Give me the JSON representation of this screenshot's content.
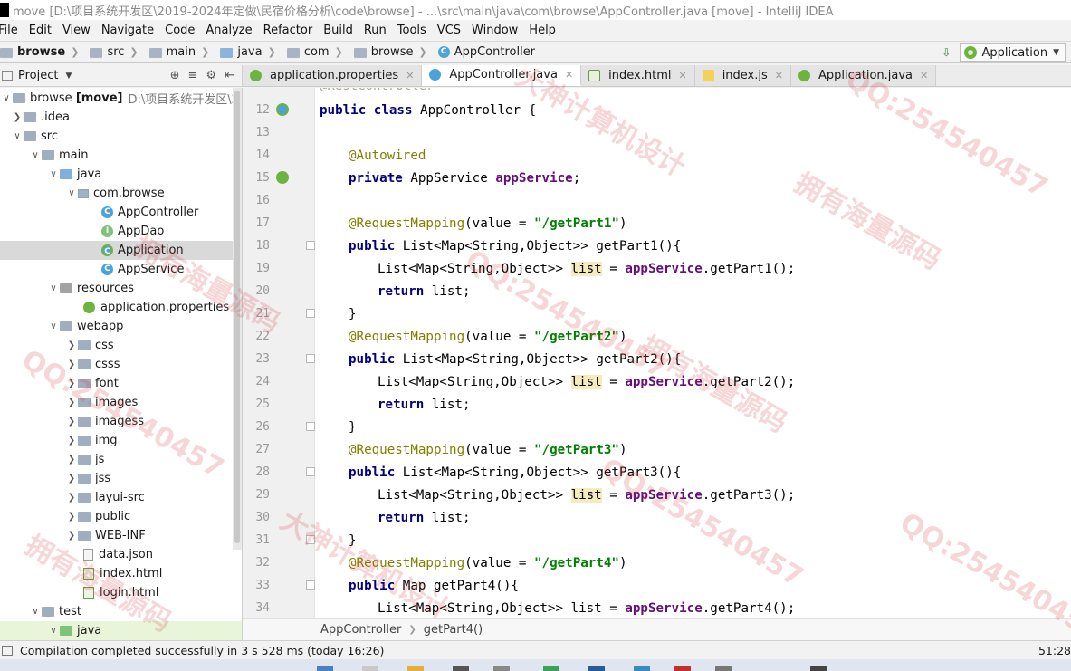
{
  "window": {
    "title": "move [D:\\项目系统开发区\\2019-2024年定做\\民宿价格分析\\code\\browse] - ...\\src\\main\\java\\com\\browse\\AppController.java [move] - IntelliJ IDEA"
  },
  "menu": [
    "File",
    "Edit",
    "View",
    "Navigate",
    "Code",
    "Analyze",
    "Refactor",
    "Build",
    "Run",
    "Tools",
    "VCS",
    "Window",
    "Help"
  ],
  "navbar": {
    "crumbs": [
      "browse",
      "src",
      "main",
      "java",
      "com",
      "browse",
      "AppController"
    ],
    "run_config": "Application"
  },
  "project_panel": {
    "title": "Project",
    "root_name": "browse",
    "root_module": "[move]",
    "root_path": "D:\\项目系统开发区\\2019-",
    "items": [
      {
        "label": ".idea",
        "icon": "folder-icon"
      },
      {
        "label": "src",
        "icon": "folder-icon"
      },
      {
        "label": "main",
        "icon": "folder-icon"
      },
      {
        "label": "java",
        "icon": "source-folder-icon"
      },
      {
        "label": "com.browse",
        "icon": "package-icon"
      },
      {
        "label": "AppController",
        "icon": "class-icon"
      },
      {
        "label": "AppDao",
        "icon": "interface-icon"
      },
      {
        "label": "Application",
        "icon": "spring-boot-class-icon"
      },
      {
        "label": "AppService",
        "icon": "class-icon"
      },
      {
        "label": "resources",
        "icon": "resources-folder-icon"
      },
      {
        "label": "application.properties",
        "icon": "spring-properties-icon"
      },
      {
        "label": "webapp",
        "icon": "folder-icon"
      },
      {
        "label": "css",
        "icon": "folder-icon"
      },
      {
        "label": "csss",
        "icon": "folder-icon"
      },
      {
        "label": "font",
        "icon": "folder-icon"
      },
      {
        "label": "images",
        "icon": "folder-icon"
      },
      {
        "label": "imagess",
        "icon": "folder-icon"
      },
      {
        "label": "img",
        "icon": "folder-icon"
      },
      {
        "label": "js",
        "icon": "folder-icon"
      },
      {
        "label": "jss",
        "icon": "folder-icon"
      },
      {
        "label": "layui-src",
        "icon": "folder-icon"
      },
      {
        "label": "public",
        "icon": "folder-icon"
      },
      {
        "label": "WEB-INF",
        "icon": "folder-icon"
      },
      {
        "label": "data.json",
        "icon": "json-file-icon"
      },
      {
        "label": "index.html",
        "icon": "html-file-icon"
      },
      {
        "label": "login.html",
        "icon": "html-file-icon"
      },
      {
        "label": "test",
        "icon": "folder-icon"
      },
      {
        "label": "java",
        "icon": "test-source-folder-icon"
      }
    ]
  },
  "tabs": [
    {
      "label": "application.properties",
      "active": false
    },
    {
      "label": "AppController.java",
      "active": true
    },
    {
      "label": "index.html",
      "active": false
    },
    {
      "label": "index.js",
      "active": false
    },
    {
      "label": "Application.java",
      "active": false
    }
  ],
  "editor": {
    "lines": [
      {
        "n": "12",
        "text": "public class AppController {"
      },
      {
        "n": "13",
        "text": ""
      },
      {
        "n": "14",
        "text": "@Autowired"
      },
      {
        "n": "15",
        "text": "private AppService appService;"
      },
      {
        "n": "16",
        "text": ""
      },
      {
        "n": "17",
        "text": "@RequestMapping(value = \"/getPart1\")"
      },
      {
        "n": "18",
        "text": "public List<Map<String,Object>> getPart1(){"
      },
      {
        "n": "19",
        "text": "List<Map<String,Object>> list = appService.getPart1();"
      },
      {
        "n": "20",
        "text": "return list;"
      },
      {
        "n": "21",
        "text": "}"
      },
      {
        "n": "22",
        "text": "@RequestMapping(value = \"/getPart2\")"
      },
      {
        "n": "23",
        "text": "public List<Map<String,Object>> getPart2(){"
      },
      {
        "n": "24",
        "text": "List<Map<String,Object>> list = appService.getPart2();"
      },
      {
        "n": "25",
        "text": "return list;"
      },
      {
        "n": "26",
        "text": "}"
      },
      {
        "n": "27",
        "text": "@RequestMapping(value = \"/getPart3\")"
      },
      {
        "n": "28",
        "text": "public List<Map<String,Object>> getPart3(){"
      },
      {
        "n": "29",
        "text": "List<Map<String,Object>> list = appService.getPart3();"
      },
      {
        "n": "30",
        "text": "return list;"
      },
      {
        "n": "31",
        "text": "}"
      },
      {
        "n": "32",
        "text": "@RequestMapping(value = \"/getPart4\")"
      },
      {
        "n": "33",
        "text": "public Map getPart4(){"
      },
      {
        "n": "34",
        "text": "List<Map<String,Object>> list = appService.getPart4();"
      }
    ],
    "breadcrumb": [
      "AppController",
      "getPart4()"
    ]
  },
  "status": {
    "message": "Compilation completed successfully in 3 s 528 ms (today 16:26)",
    "position": "51:28"
  },
  "watermarks": [
    "QQ:254540457",
    "拥有海量源码",
    "大神计算机设计"
  ]
}
